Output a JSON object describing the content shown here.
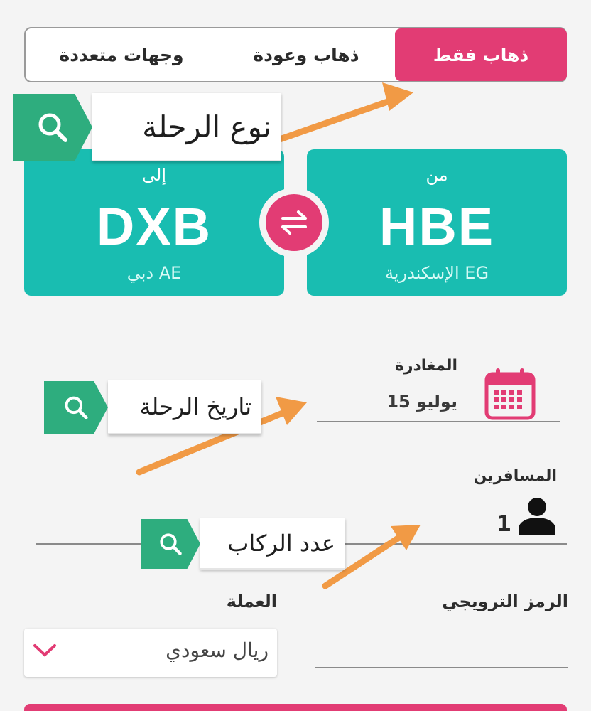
{
  "trip_types": {
    "one_way": "ذهاب فقط",
    "round_trip": "ذهاب وعودة",
    "multi_city": "وجهات متعددة"
  },
  "origin": {
    "direction_label": "من",
    "code": "HBE",
    "city": "الإسكندرية",
    "country": "EG"
  },
  "destination": {
    "direction_label": "إلى",
    "code": "DXB",
    "city": "دبي",
    "country": "AE"
  },
  "departure": {
    "label": "المغادرة",
    "value": "15 يوليو"
  },
  "passengers": {
    "label": "المسافرين",
    "count": "1"
  },
  "promo": {
    "label": "الرمز الترويجي",
    "value": ""
  },
  "currency": {
    "label": "العملة",
    "value": "ريال سعودي"
  },
  "annotations": {
    "trip_type": "نوع الرحلة",
    "trip_date": "تاريخ الرحلة",
    "passenger_count": "عدد الركاب"
  },
  "colors": {
    "accent": "#e23c74",
    "teal": "#19bdb1",
    "tag_green": "#2ead7e",
    "arrow": "#f19a45"
  }
}
